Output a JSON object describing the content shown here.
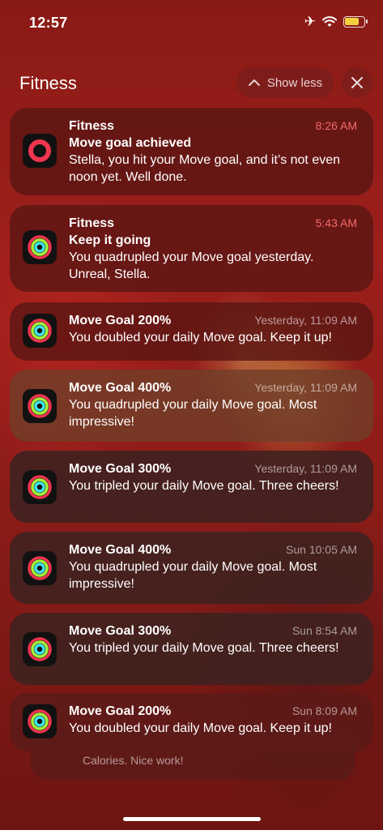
{
  "status_bar": {
    "time": "12:57",
    "battery_level": 0.8
  },
  "group": {
    "title": "Fitness",
    "show_less_label": "Show less"
  },
  "notifications": [
    {
      "app": "Fitness",
      "title": "Move goal achieved",
      "time": "8:26 AM",
      "body": "Stella, you hit your Move goal, and it’s not even noon yet. Well done."
    },
    {
      "app": "Fitness",
      "title": "Keep it going",
      "time": "5:43 AM",
      "body": "You quadrupled your Move goal yesterday. Unreal, Stella."
    },
    {
      "title": "Move Goal 200%",
      "time": "Yesterday, 11:09 AM",
      "body": "You doubled your daily Move goal. Keep it up!"
    },
    {
      "title": "Move Goal 400%",
      "time": "Yesterday, 11:09 AM",
      "body": "You quadrupled your daily Move goal. Most impressive!"
    },
    {
      "title": "Move Goal 300%",
      "time": "Yesterday, 11:09 AM",
      "body": "You tripled your daily Move goal. Three cheers!"
    },
    {
      "title": "Move Goal 400%",
      "time": "Sun 10:05 AM",
      "body": "You quadrupled your daily Move goal. Most impressive!"
    },
    {
      "title": "Move Goal 300%",
      "time": "Sun 8:54 AM",
      "body": "You tripled your daily Move goal. Three cheers!"
    },
    {
      "title": "Move Goal 200%",
      "time": "Sun 8:09 AM",
      "body": "You doubled your daily Move goal. Keep it up!"
    }
  ],
  "behind_notification": {
    "body": "Calories. Nice work!"
  },
  "colors": {
    "move_ring": "#f0354f",
    "exercise_ring": "#a6f33a",
    "stand_ring": "#3fe3f0",
    "time_accent": "#f26b6b"
  }
}
